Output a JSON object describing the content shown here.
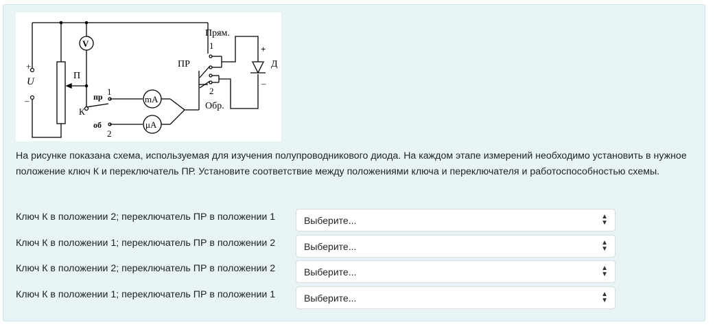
{
  "figure": {
    "labels": {
      "plus_u": "+",
      "u": "U",
      "minus_u": "–",
      "potentiometer": "П",
      "voltmeter": "V",
      "key": "К",
      "pr": "пр",
      "ob": "об",
      "pos1": "1",
      "pos2": "2",
      "milliammeter": "mA",
      "microammeter": "μA",
      "switch": "ПР",
      "forward": "Прям.",
      "reverse": "Обр.",
      "sw_pos1": "1",
      "sw_pos2": "2",
      "diode_plus": "+",
      "diode_minus": "–",
      "diode": "Д"
    }
  },
  "question": {
    "text": "На рисунке показана схема, используемая для изучения полупроводникового диода. На каждом этапе измерений необходимо установить в нужное положение ключ К и переключатель ПР. Установите соответствие между положениями ключа и переключателя и работоспособностью схемы."
  },
  "rows": [
    {
      "label": "Ключ К в положении 2; переключатель ПР в положении 1",
      "value": "Выберите..."
    },
    {
      "label": "Ключ К в положении 1; переключатель ПР в положении 2",
      "value": "Выберите..."
    },
    {
      "label": "Ключ К в положении 2; переключатель ПР в положении 2",
      "value": "Выберите..."
    },
    {
      "label": "Ключ К в положении 1; переключатель ПР в положении 1",
      "value": "Выберите..."
    }
  ],
  "select_arrow": {
    "up": "▲",
    "down": "▼"
  }
}
